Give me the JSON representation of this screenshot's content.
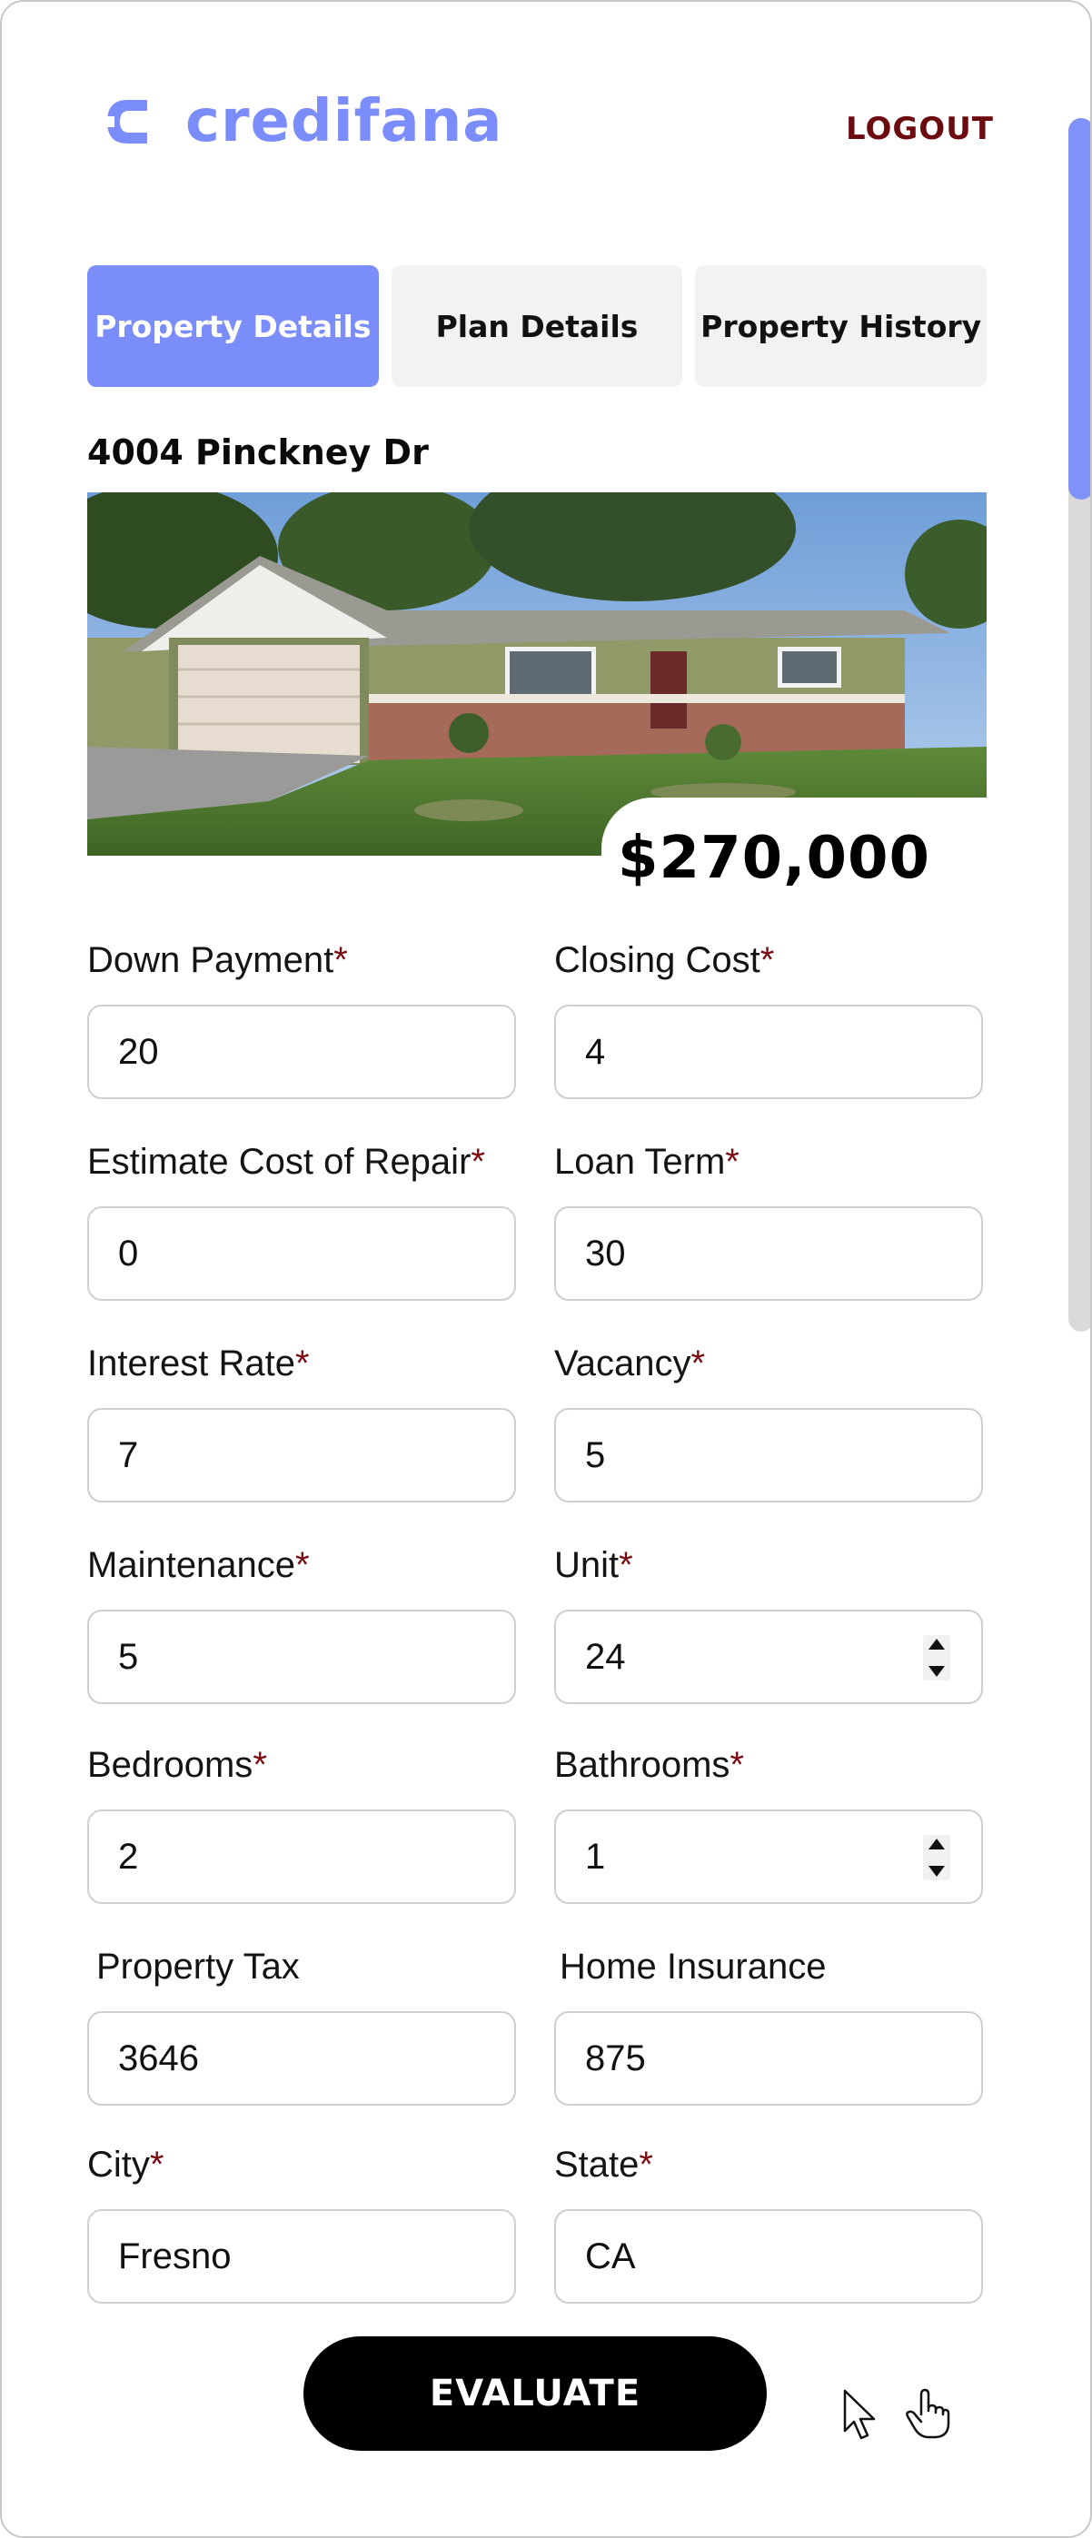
{
  "brand": {
    "name": "credifana",
    "color": "#7b8cfb"
  },
  "header": {
    "logout_label": "LOGOUT"
  },
  "tabs": [
    {
      "label": "Property Details",
      "active": true
    },
    {
      "label": "Plan Details",
      "active": false
    },
    {
      "label": "Property History",
      "active": false
    }
  ],
  "property": {
    "address": "4004 Pinckney Dr",
    "price": "$270,000"
  },
  "form": {
    "down_payment": {
      "label": "Down Payment",
      "required": "*",
      "value": "20"
    },
    "closing_cost": {
      "label": "Closing Cost",
      "required": "*",
      "value": "4"
    },
    "estimate_cost_of_repair": {
      "label": "Estimate Cost of Repair",
      "required": "*",
      "value": "0"
    },
    "loan_term": {
      "label": "Loan Term",
      "required": "*",
      "value": "30"
    },
    "interest_rate": {
      "label": "Interest Rate",
      "required": "*",
      "value": "7"
    },
    "vacancy": {
      "label": "Vacancy",
      "required": "*",
      "value": "5"
    },
    "maintenance": {
      "label": "Maintenance",
      "required": "*",
      "value": "5"
    },
    "unit": {
      "label": "Unit",
      "required": "*",
      "value": "24"
    },
    "bedrooms": {
      "label": "Bedrooms",
      "required": "*",
      "value": "2"
    },
    "bathrooms": {
      "label": "Bathrooms",
      "required": "*",
      "value": "1"
    },
    "property_tax": {
      "label": "Property Tax",
      "value": "3646"
    },
    "home_insurance": {
      "label": "Home Insurance",
      "value": "875"
    },
    "city": {
      "label": "City",
      "required": "*",
      "value": "Fresno"
    },
    "state": {
      "label": "State",
      "required": "*",
      "value": "CA"
    }
  },
  "actions": {
    "evaluate_label": "EVALUATE"
  },
  "colors": {
    "accent": "#7b8cfb",
    "required": "#7a0c12",
    "logout": "#6b0b10"
  }
}
